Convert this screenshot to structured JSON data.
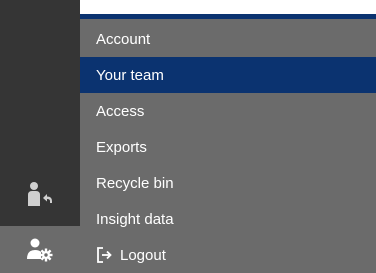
{
  "menu": {
    "items": [
      {
        "label": "Account"
      },
      {
        "label": "Your team"
      },
      {
        "label": "Access"
      },
      {
        "label": "Exports"
      },
      {
        "label": "Recycle bin"
      },
      {
        "label": "Insight data"
      },
      {
        "label": "Logout",
        "icon": "logout-icon"
      }
    ],
    "active_index": 1
  },
  "rail": {
    "buttons": [
      {
        "icon": "switch-user-icon"
      },
      {
        "icon": "user-settings-icon"
      }
    ]
  },
  "colors": {
    "rail": "#353535",
    "menu_bg": "#6b6b6b",
    "active": "#0b3370",
    "text": "#ffffff",
    "icon": "#d0d0d0"
  }
}
